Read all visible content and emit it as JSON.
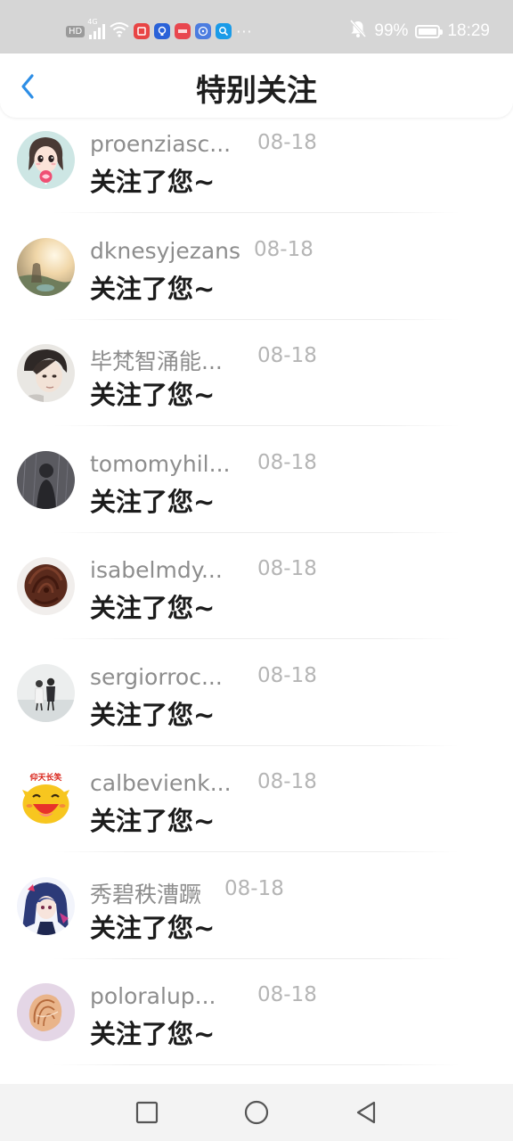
{
  "status_bar": {
    "badge": "HD",
    "network": "4G",
    "battery": "99%",
    "battery_level": 0.99,
    "time": "18:29",
    "more": "···",
    "icons": [
      "hd-badge-icon",
      "signal-icon",
      "wifi-icon",
      "red-app-icon",
      "blue-app-icon",
      "red-app-icon",
      "music-app-icon",
      "search-app-icon",
      "mute-bell-icon",
      "battery-icon"
    ]
  },
  "header": {
    "title": "特别关注",
    "back_icon": "chevron-left-icon",
    "accent": "#2d8ee6"
  },
  "list": {
    "items": [
      {
        "name": "proenziasc...",
        "date": "08-18",
        "message": "关注了您~",
        "avatar": "girl-lollipop-avatar"
      },
      {
        "name": "dknesyjezans",
        "date": "08-18",
        "message": "关注了您~",
        "avatar": "sunset-field-avatar"
      },
      {
        "name": "毕梵智涌能...",
        "date": "08-18",
        "message": "关注了您~",
        "avatar": "boy-portrait-avatar"
      },
      {
        "name": "tomomyhil...",
        "date": "08-18",
        "message": "关注了您~",
        "avatar": "rainy-figure-avatar"
      },
      {
        "name": "isabelmdy...",
        "date": "08-18",
        "message": "关注了您~",
        "avatar": "chocolate-rose-avatar"
      },
      {
        "name": "sergiorroc...",
        "date": "08-18",
        "message": "关注了您~",
        "avatar": "couple-snow-avatar"
      },
      {
        "name": "calbevienk...",
        "date": "08-18",
        "message": "关注了您~",
        "avatar": "laughing-cartoon-avatar"
      },
      {
        "name": "秀碧秩漕蹶",
        "date": "08-18",
        "message": "关注了您~",
        "avatar": "anime-girl-avatar"
      },
      {
        "name": "poloralup...",
        "date": "08-18",
        "message": "关注了您~",
        "avatar": "seashell-avatar"
      }
    ],
    "cartoon_caption": "仰天长笑"
  },
  "nav_bar": {
    "icons": [
      "recent-apps-icon",
      "home-icon",
      "back-triangle-icon"
    ]
  }
}
